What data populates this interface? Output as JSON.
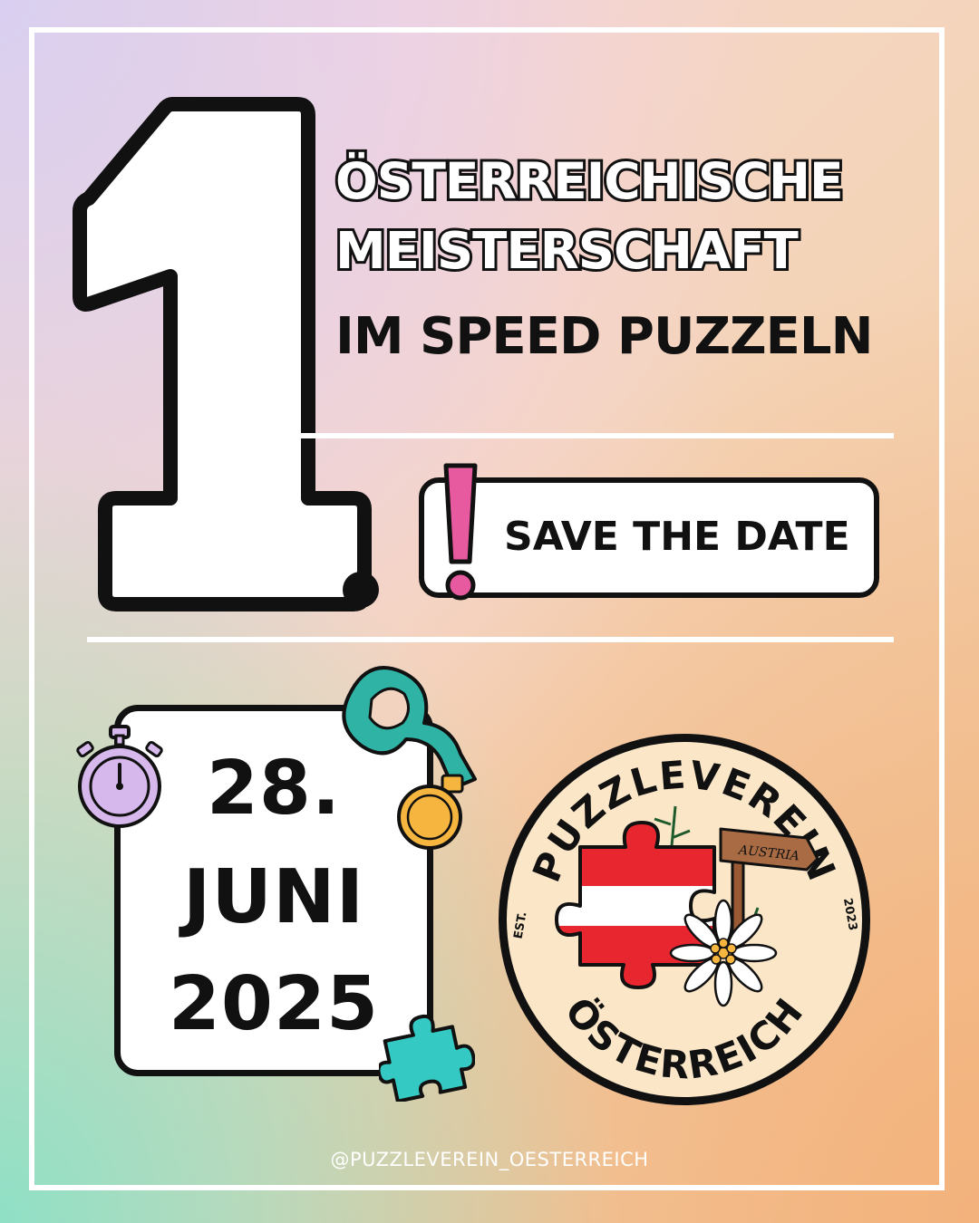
{
  "headline": {
    "line1": "ÖSTERREICHISCHE",
    "line2": "MEISTERSCHAFT",
    "line3": "IM SPEED PUZZELN"
  },
  "big_number": "1",
  "save_the_date": "SAVE THE DATE",
  "date": {
    "day": "28.",
    "month": "JUNI",
    "year": "2025"
  },
  "badge": {
    "top_text": "PUZZLEVEREIN",
    "bottom_text": "ÖSTERREICH",
    "sign_text": "AUSTRIA",
    "est_label": "EST.",
    "est_year": "2023"
  },
  "footer_handle": "@PUZZLEVEREIN_OESTERREICH",
  "colors": {
    "outline": "#111111",
    "card": "#ffffff",
    "exclamation": "#e85aa0",
    "flag_red": "#e8262f",
    "medal_ribbon": "#2fb3a5",
    "medal_gold": "#f5b53e",
    "stopwatch": "#d6b8ec",
    "puzzle_teal": "#34c9c3",
    "badge_bg": "#fbe7c8"
  }
}
